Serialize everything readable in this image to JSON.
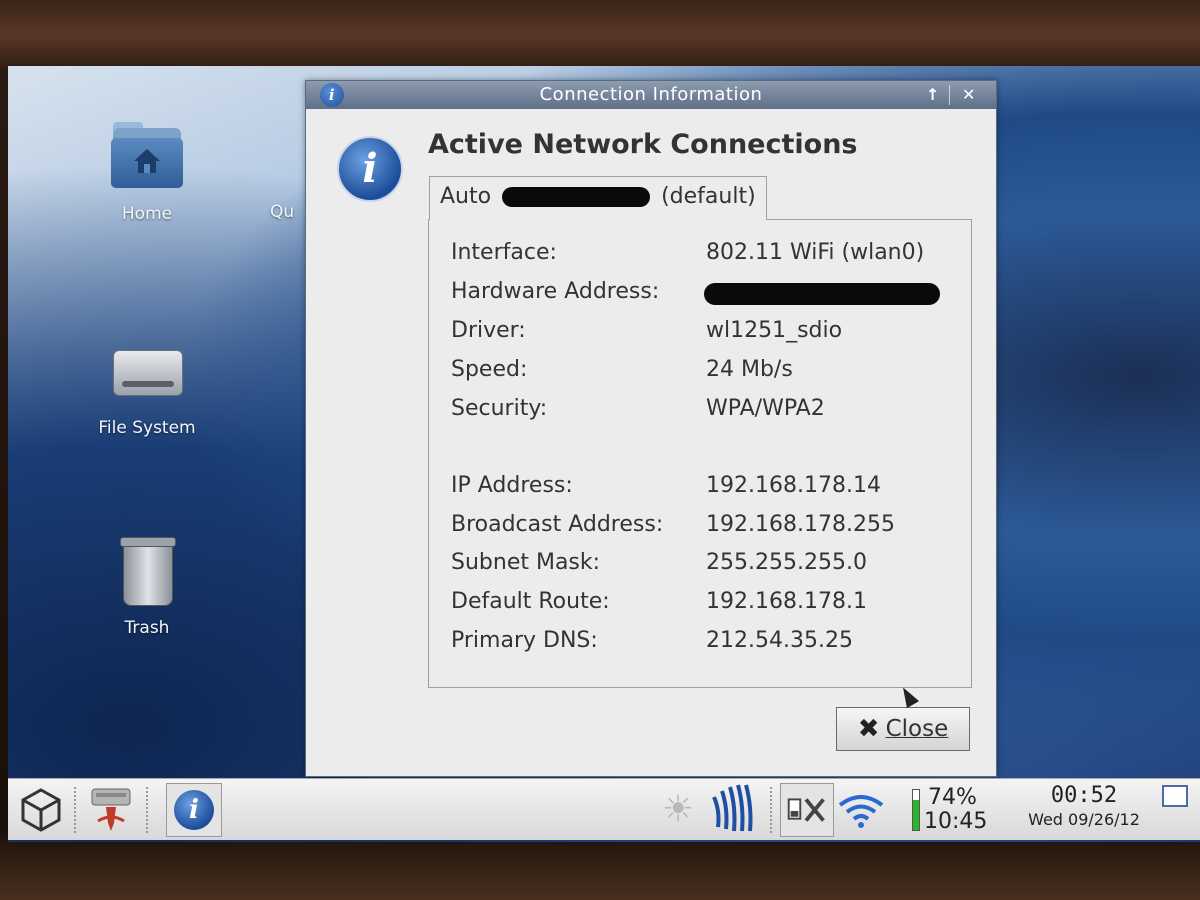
{
  "desktop": {
    "icons": [
      {
        "label": "Home"
      },
      {
        "label": "File System"
      },
      {
        "label": "Trash"
      }
    ],
    "partial_label": "Qu"
  },
  "window": {
    "title": "Connection Information",
    "heading": "Active Network Connections",
    "tab": {
      "prefix": "Auto",
      "suffix": "(default)"
    },
    "rows": [
      {
        "label": "Interface:",
        "value": "802.11 WiFi (wlan0)"
      },
      {
        "label": "Hardware Address:",
        "value": ""
      },
      {
        "label": "Driver:",
        "value": "wl1251_sdio"
      },
      {
        "label": "Speed:",
        "value": "24 Mb/s"
      },
      {
        "label": "Security:",
        "value": "WPA/WPA2"
      },
      {
        "label": "IP Address:",
        "value": "192.168.178.14"
      },
      {
        "label": "Broadcast Address:",
        "value": "192.168.178.255"
      },
      {
        "label": "Subnet Mask:",
        "value": "255.255.255.0"
      },
      {
        "label": "Default Route:",
        "value": "192.168.178.1"
      },
      {
        "label": "Primary DNS:",
        "value": "212.54.35.25"
      }
    ],
    "close_label": "Close"
  },
  "taskbar": {
    "battery_percent": "74%",
    "battery_time": "10:45",
    "battery_level": 0.74,
    "clock_time": "00:52",
    "clock_date": "Wed 09/26/12"
  },
  "icons": {
    "window_icon": "info-icon",
    "maximize": "arrow-up-icon",
    "close": "close-icon"
  }
}
